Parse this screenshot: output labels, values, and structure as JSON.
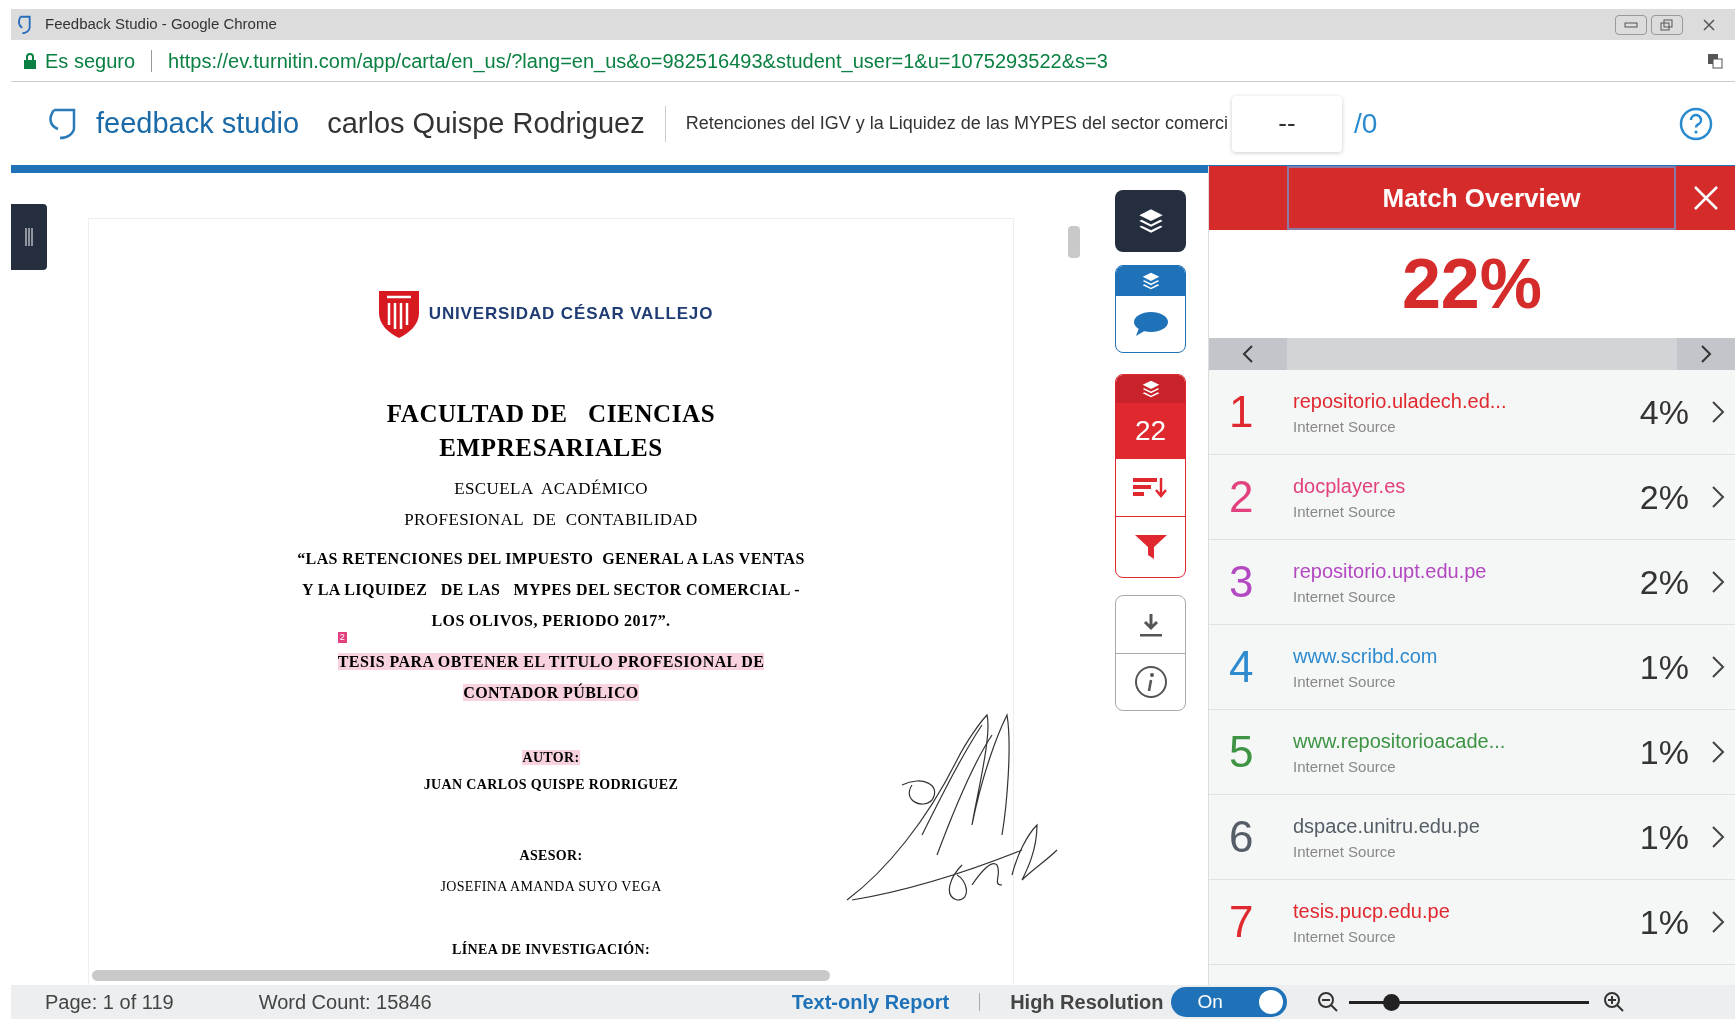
{
  "browser": {
    "title": "Feedback Studio - Google Chrome",
    "secure_label": "Es seguro",
    "url_host": "https://ev.turnitin.com",
    "url_path": "/app/carta/en_us/?lang=en_us&o=982516493&student_user=1&u=1075293522&s=3"
  },
  "header": {
    "logo_text": "feedback studio",
    "student": "carlos Quispe Rodriguez",
    "paper_title": "Retenciones del IGV y la Liquidez de las MYPES del sector comerci",
    "grade": "--",
    "grade_total": "/0"
  },
  "document": {
    "university": "UNIVERSIDAD CÉSAR VALLEJO",
    "match_marker": "2",
    "lines": [
      {
        "text": "FACULTAD DE   CIENCIAS",
        "kind": "title",
        "highlighted": false
      },
      {
        "text": "EMPRESARIALES",
        "kind": "title",
        "highlighted": false
      },
      {
        "text": "ESCUELA  ACADÉMICO",
        "kind": "plain",
        "highlighted": false
      },
      {
        "text": "PROFESIONAL  DE  CONTABILIDAD",
        "kind": "plain",
        "highlighted": false
      },
      {
        "text": "“LAS RETENCIONES DEL IMPUESTO  GENERAL A LAS VENTAS",
        "kind": "bold",
        "highlighted": false
      },
      {
        "text": "Y LA LIQUIDEZ   DE LAS   MYPES DEL SECTOR COMERCIAL -",
        "kind": "bold",
        "highlighted": false
      },
      {
        "text": "LOS OLIVOS, PERIODO 2017”.",
        "kind": "bold",
        "highlighted": false
      },
      {
        "text": "TESIS PARA OBTENER EL TITULO PROFESIONAL DE",
        "kind": "bold",
        "highlighted": true
      },
      {
        "text": "CONTADOR PÚBLICO",
        "kind": "bold",
        "highlighted": true
      },
      {
        "text": "AUTOR:",
        "kind": "small",
        "highlighted": true
      },
      {
        "text": "JUAN CARLOS QUISPE RODRIGUEZ",
        "kind": "small",
        "highlighted": false
      },
      {
        "text": "ASESOR:",
        "kind": "small",
        "highlighted": false
      },
      {
        "text": "JOSEFINA AMANDA SUYO VEGA",
        "kind": "smallplain",
        "highlighted": false
      },
      {
        "text": "LÍNEA DE INVESTIGACIÓN:",
        "kind": "small",
        "highlighted": false
      }
    ]
  },
  "tools": {
    "match_count": "22"
  },
  "panel": {
    "title": "Match Overview",
    "score": "22%",
    "matches": [
      {
        "rank": "1",
        "source": "repositorio.uladech.ed...",
        "type": "Internet Source",
        "percent": "4%",
        "color": "#e0282f"
      },
      {
        "rank": "2",
        "source": "docplayer.es",
        "type": "Internet Source",
        "percent": "2%",
        "color": "#e2407e"
      },
      {
        "rank": "3",
        "source": "repositorio.upt.edu.pe",
        "type": "Internet Source",
        "percent": "2%",
        "color": "#b348c2"
      },
      {
        "rank": "4",
        "source": "www.scribd.com",
        "type": "Internet Source",
        "percent": "1%",
        "color": "#2e8bd0"
      },
      {
        "rank": "5",
        "source": "www.repositorioacade...",
        "type": "Internet Source",
        "percent": "1%",
        "color": "#3d9444"
      },
      {
        "rank": "6",
        "source": "dspace.unitru.edu.pe",
        "type": "Internet Source",
        "percent": "1%",
        "color": "#555d66"
      },
      {
        "rank": "7",
        "source": "tesis.pucp.edu.pe",
        "type": "Internet Source",
        "percent": "1%",
        "color": "#e0282f"
      }
    ]
  },
  "status_bar": {
    "page": "Page: 1 of 119",
    "word_count": "Word Count: 15846",
    "text_only_link": "Text-only Report",
    "high_res_label": "High Resolution",
    "high_res": {
      "on": true,
      "label": "On"
    },
    "zoom": {
      "level": 0.15
    }
  }
}
